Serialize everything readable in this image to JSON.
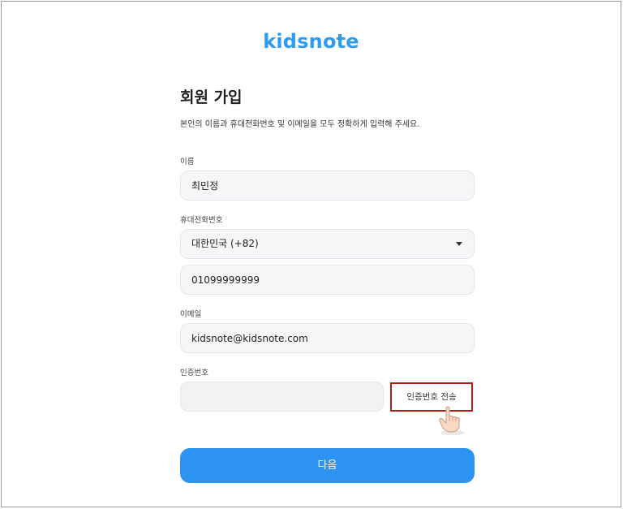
{
  "brand": {
    "logo_text": "kidsnote"
  },
  "form": {
    "title": "회원 가입",
    "subtitle": "본인의 이름과 휴대전화번호 및 이메일을 모두 정확하게 입력해 주세요.",
    "name": {
      "label": "이름",
      "value": "최민정"
    },
    "phone": {
      "label": "휴대전화번호",
      "country_selected": "대한민국 (+82)",
      "number_value": "01099999999"
    },
    "email": {
      "label": "이메일",
      "value": "kidsnote@kidsnote.com"
    },
    "verification": {
      "label": "인증번호",
      "value": "",
      "send_button_label": "인증번호 전송"
    },
    "next_button_label": "다음"
  },
  "colors": {
    "accent": "#2d93f3",
    "highlight_border": "#b71c1c",
    "logo": "#2f9cf0"
  },
  "icons": {
    "pointer": "hand-pointer-icon",
    "dropdown": "chevron-down-icon"
  }
}
